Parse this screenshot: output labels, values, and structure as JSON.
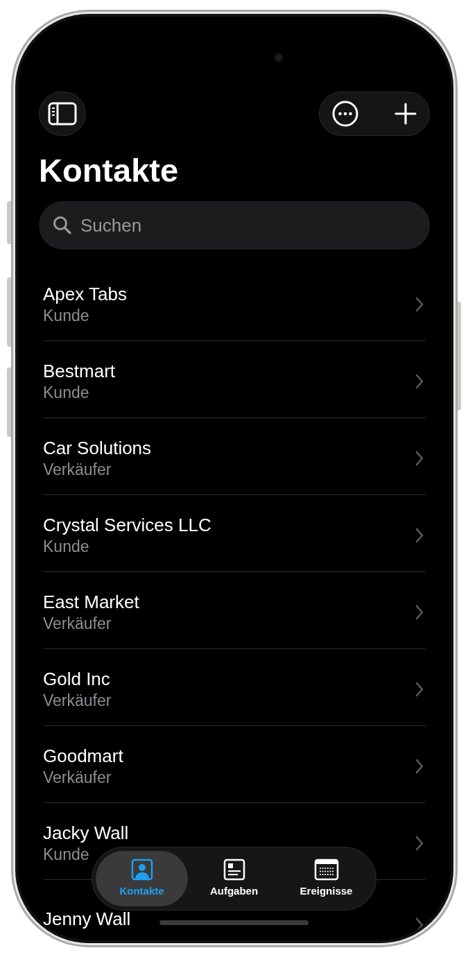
{
  "title": "Kontakte",
  "search": {
    "placeholder": "Suchen"
  },
  "contacts": [
    {
      "name": "Apex Tabs",
      "role": "Kunde"
    },
    {
      "name": "Bestmart",
      "role": "Kunde"
    },
    {
      "name": "Car Solutions",
      "role": "Verkäufer"
    },
    {
      "name": "Crystal Services LLC",
      "role": "Kunde"
    },
    {
      "name": "East Market",
      "role": "Verkäufer"
    },
    {
      "name": "Gold Inc",
      "role": "Verkäufer"
    },
    {
      "name": "Goodmart",
      "role": "Verkäufer"
    },
    {
      "name": "Jacky Wall",
      "role": "Kunde"
    },
    {
      "name": "Jenny Wall"
    }
  ],
  "tabs": [
    {
      "kind": "contacts",
      "label": "Kontakte",
      "selected": true
    },
    {
      "kind": "tasks",
      "label": "Aufgaben",
      "selected": false
    },
    {
      "kind": "events",
      "label": "Ereignisse",
      "selected": false
    }
  ]
}
